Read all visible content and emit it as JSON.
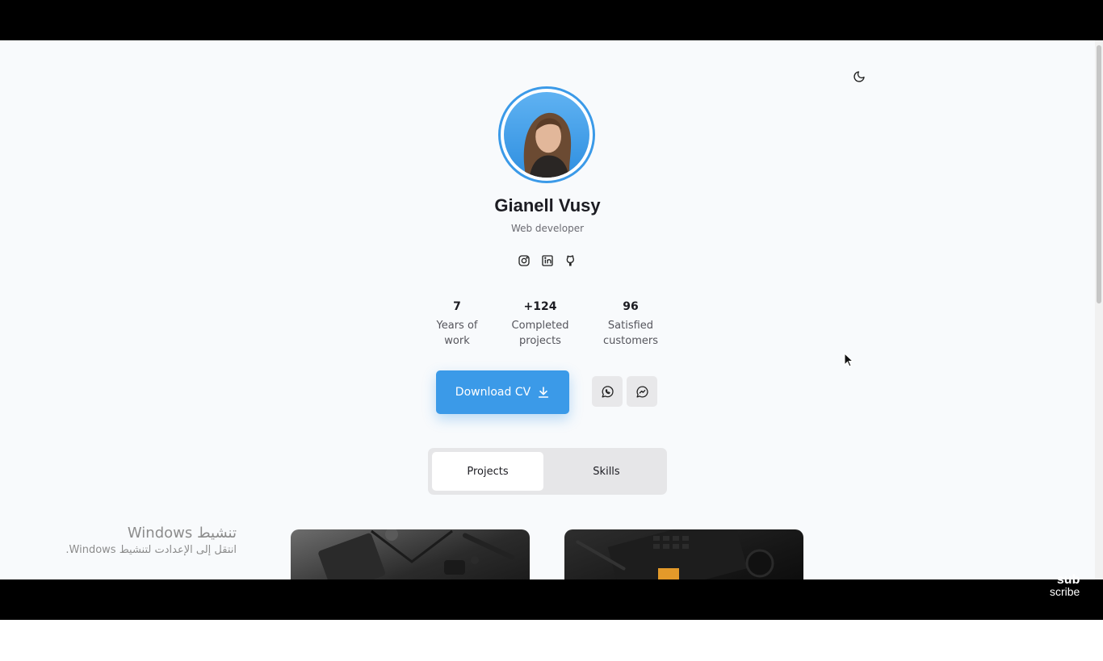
{
  "profile": {
    "name": "Gianell Vusy",
    "role": "Web developer"
  },
  "socials": [
    "instagram-icon",
    "linkedin-icon",
    "github-icon"
  ],
  "stats": [
    {
      "value": "7",
      "label": "Years of\nwork"
    },
    {
      "value": "+124",
      "label": "Completed\nprojects"
    },
    {
      "value": "96",
      "label": "Satisfied\ncustomers"
    }
  ],
  "actions": {
    "download_label": "Download CV",
    "download_icon": "download-icon",
    "contact_icons": [
      "whatsapp-icon",
      "messenger-icon"
    ]
  },
  "tabs": [
    {
      "label": "Projects",
      "active": true
    },
    {
      "label": "Skills",
      "active": false
    }
  ],
  "theme_toggle_icon": "moon-icon",
  "accent_color": "#3b9ae8",
  "windows_watermark": {
    "title": "تنشيط Windows",
    "subtitle": "انتقل إلى الإعدادت لتنشيط Windows."
  },
  "overlay_logo": {
    "line1": "sub",
    "line2": "scribe"
  }
}
